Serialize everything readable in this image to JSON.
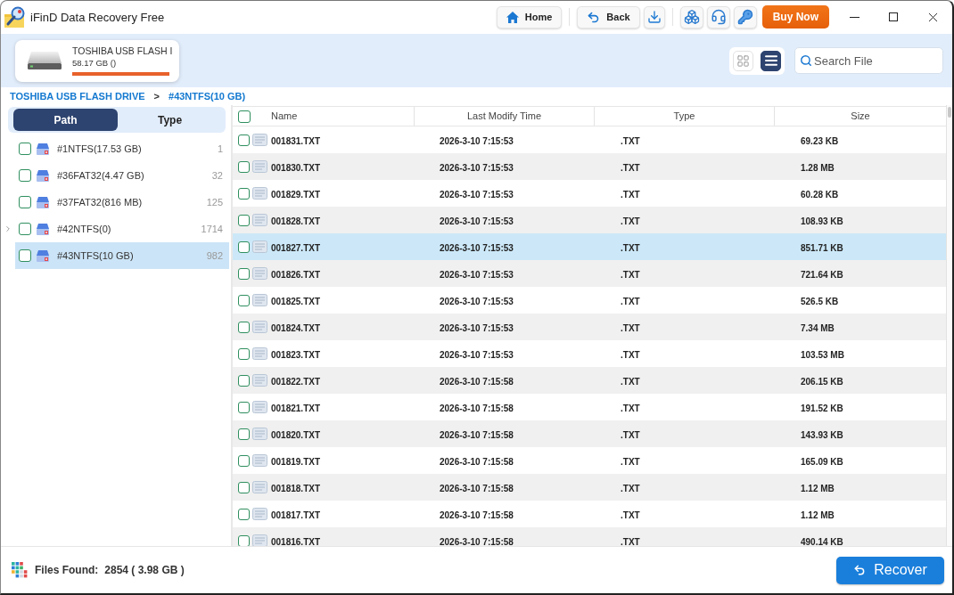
{
  "window": {
    "title": "iFinD Data Recovery Free"
  },
  "toolbar": {
    "groups": [
      [
        {
          "kind": "home",
          "label": "Home"
        }
      ],
      [
        {
          "kind": "back",
          "label": "Back"
        },
        {
          "kind": "download"
        }
      ],
      [
        {
          "kind": "network"
        },
        {
          "kind": "support"
        },
        {
          "kind": "key"
        },
        {
          "kind": "buy",
          "label": "Buy Now"
        }
      ]
    ]
  },
  "drive_card": {
    "name": "TOSHIBA USB FLASH I",
    "capacity": "58.17 GB ()",
    "level": 1
  },
  "view_toggle": [
    {
      "kind": "grid",
      "selected": false
    },
    {
      "kind": "list",
      "selected": true
    }
  ],
  "search": {
    "placeholder": "Search File"
  },
  "breadcrumb": {
    "items": [
      "TOSHIBA USB FLASH DRIVE",
      "#43NTFS(10 GB)"
    ],
    "separator": ">"
  },
  "sidebar": {
    "tabs": [
      {
        "label": "Path",
        "selected": true
      },
      {
        "label": "Type",
        "selected": false
      }
    ],
    "items": [
      {
        "label": "#1NTFS(17.53 GB)",
        "count": "1",
        "checked": false,
        "expandable": false,
        "selected": false
      },
      {
        "label": "#36FAT32(4.47 GB)",
        "count": "32",
        "checked": false,
        "expandable": false,
        "selected": false
      },
      {
        "label": "#37FAT32(816 MB)",
        "count": "125",
        "checked": false,
        "expandable": false,
        "selected": false
      },
      {
        "label": "#42NTFS(0)",
        "count": "1714",
        "checked": false,
        "expandable": true,
        "selected": false
      },
      {
        "label": "#43NTFS(10 GB)",
        "count": "982",
        "checked": false,
        "expandable": false,
        "selected": true
      }
    ]
  },
  "table": {
    "select_all_checked": false,
    "columns": [
      "Name",
      "Last Modify Time",
      "Type",
      "Size"
    ],
    "rows": [
      {
        "name": "001831.TXT",
        "modified": "2026-3-10 7:15:53",
        "type": ".TXT",
        "size": "69.23 KB",
        "checked": false,
        "selected": false
      },
      {
        "name": "001830.TXT",
        "modified": "2026-3-10 7:15:53",
        "type": ".TXT",
        "size": "1.28 MB",
        "checked": false,
        "selected": false
      },
      {
        "name": "001829.TXT",
        "modified": "2026-3-10 7:15:53",
        "type": ".TXT",
        "size": "60.28 KB",
        "checked": false,
        "selected": false
      },
      {
        "name": "001828.TXT",
        "modified": "2026-3-10 7:15:53",
        "type": ".TXT",
        "size": "108.93 KB",
        "checked": false,
        "selected": false
      },
      {
        "name": "001827.TXT",
        "modified": "2026-3-10 7:15:53",
        "type": ".TXT",
        "size": "851.71 KB",
        "checked": false,
        "selected": true
      },
      {
        "name": "001826.TXT",
        "modified": "2026-3-10 7:15:53",
        "type": ".TXT",
        "size": "721.64 KB",
        "checked": false,
        "selected": false
      },
      {
        "name": "001825.TXT",
        "modified": "2026-3-10 7:15:53",
        "type": ".TXT",
        "size": "526.5 KB",
        "checked": false,
        "selected": false
      },
      {
        "name": "001824.TXT",
        "modified": "2026-3-10 7:15:53",
        "type": ".TXT",
        "size": "7.34 MB",
        "checked": false,
        "selected": false
      },
      {
        "name": "001823.TXT",
        "modified": "2026-3-10 7:15:53",
        "type": ".TXT",
        "size": "103.53 MB",
        "checked": false,
        "selected": false
      },
      {
        "name": "001822.TXT",
        "modified": "2026-3-10 7:15:58",
        "type": ".TXT",
        "size": "206.15 KB",
        "checked": false,
        "selected": false
      },
      {
        "name": "001821.TXT",
        "modified": "2026-3-10 7:15:58",
        "type": ".TXT",
        "size": "191.52 KB",
        "checked": false,
        "selected": false
      },
      {
        "name": "001820.TXT",
        "modified": "2026-3-10 7:15:58",
        "type": ".TXT",
        "size": "143.93 KB",
        "checked": false,
        "selected": false
      },
      {
        "name": "001819.TXT",
        "modified": "2026-3-10 7:15:58",
        "type": ".TXT",
        "size": "165.09 KB",
        "checked": false,
        "selected": false
      },
      {
        "name": "001818.TXT",
        "modified": "2026-3-10 7:15:58",
        "type": ".TXT",
        "size": "1.12 MB",
        "checked": false,
        "selected": false
      },
      {
        "name": "001817.TXT",
        "modified": "2026-3-10 7:15:58",
        "type": ".TXT",
        "size": "1.12 MB",
        "checked": false,
        "selected": false
      },
      {
        "name": "001816.TXT",
        "modified": "2026-3-10 7:15:58",
        "type": ".TXT",
        "size": "490.14 KB",
        "checked": false,
        "selected": false
      }
    ]
  },
  "status_bar": {
    "label": "Files Found:",
    "value": "2854 ( 3.98 GB )"
  },
  "recover_button": {
    "label": "Recover"
  }
}
